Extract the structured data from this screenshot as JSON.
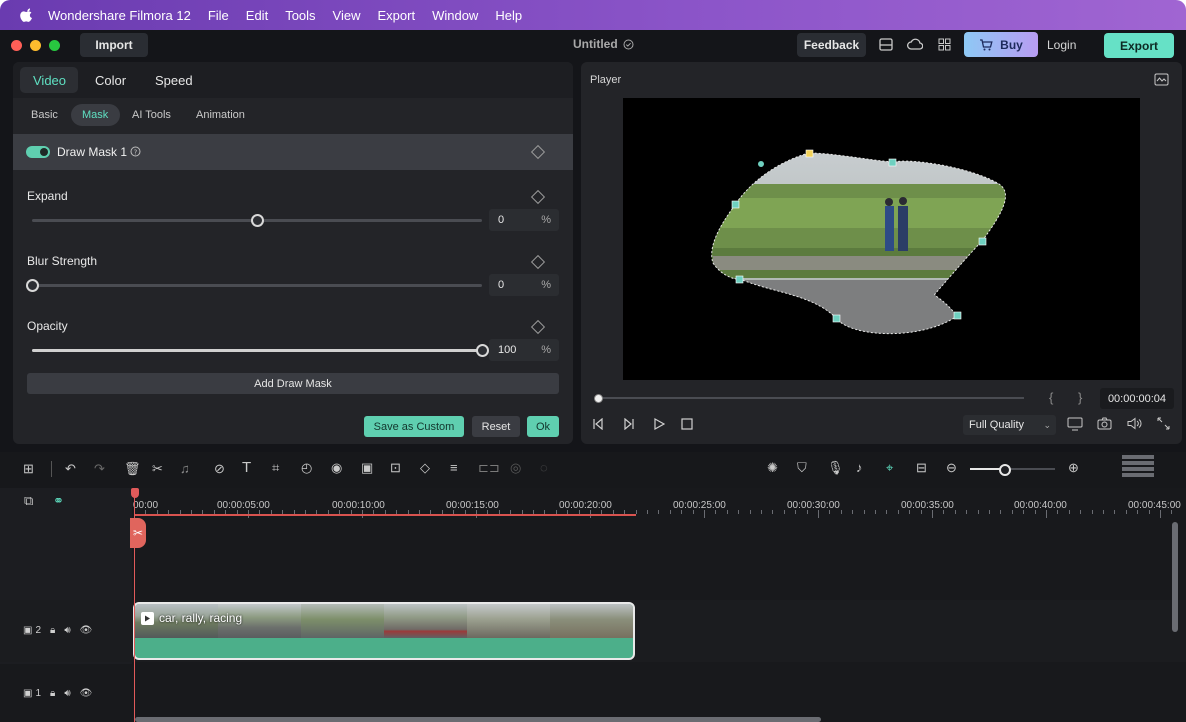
{
  "menubar": {
    "app_name": "Wondershare Filmora 12",
    "items": [
      "File",
      "Edit",
      "Tools",
      "View",
      "Export",
      "Window",
      "Help"
    ]
  },
  "titlebar": {
    "import_label": "Import",
    "project_title": "Untitled",
    "feedback_label": "Feedback",
    "buy_label": "Buy",
    "login_label": "Login",
    "export_label": "Export"
  },
  "properties": {
    "tabs": [
      "Video",
      "Color",
      "Speed"
    ],
    "active_tab": "Video",
    "subtabs": [
      "Basic",
      "Mask",
      "AI Tools",
      "Animation"
    ],
    "active_subtab": "Mask",
    "mask_name": "Draw Mask 1",
    "mask_enabled": true,
    "expand": {
      "label": "Expand",
      "value": "0",
      "unit": "%",
      "level": 0.5
    },
    "blur": {
      "label": "Blur Strength",
      "value": "0",
      "unit": "%",
      "level": 0
    },
    "opacity": {
      "label": "Opacity",
      "value": "100",
      "unit": "%",
      "level": 1
    },
    "add_mask_label": "Add Draw Mask",
    "save_custom_label": "Save as Custom",
    "reset_label": "Reset",
    "ok_label": "Ok"
  },
  "player": {
    "title": "Player",
    "timecode": "00:00:00:04",
    "quality": "Full Quality",
    "progress": 0
  },
  "timeline": {
    "ruler": [
      "00:00",
      "00:00:05:00",
      "00:00:10:00",
      "00:00:15:00",
      "00:00:20:00",
      "00:00:25:00",
      "00:00:30:00",
      "00:00:35:00",
      "00:00:40:00",
      "00:00:45:00"
    ],
    "clip_title": "car, rally, racing",
    "track2_label": "2",
    "track1_label": "1",
    "zoom_level": 0.4
  },
  "colors": {
    "accent": "#5fcfb0",
    "clip_green": "#4caf8a",
    "playhead": "#e05a5a",
    "menubar": "#8c55c9"
  }
}
